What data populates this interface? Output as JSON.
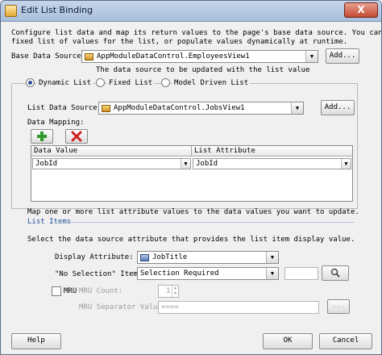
{
  "window": {
    "title": "Edit List Binding",
    "close_label": "X"
  },
  "intro": {
    "line1": "Configure list data and map its return values to the page's base data source. You can create a",
    "line2": "fixed list of values for the list, or populate values dynamically at runtime."
  },
  "base_data_source": {
    "label": "Base Data Source:",
    "value": "AppModuleDataControl.EmployeesView1",
    "add_label": "Add...",
    "help": "The data source to be updated with the list value"
  },
  "list_type": {
    "options": [
      "Dynamic List",
      "Fixed List",
      "Model Driven List"
    ],
    "selected": "Dynamic List"
  },
  "list_data_source": {
    "label": "List Data Source:",
    "value": "AppModuleDataControl.JobsView1",
    "add_label": "Add..."
  },
  "data_mapping": {
    "label": "Data Mapping:",
    "add_icon": "add-icon",
    "delete_icon": "delete-icon",
    "columns": [
      "Data Value",
      "List Attribute"
    ],
    "rows": [
      {
        "data_value": "JobId",
        "list_attribute": "JobId"
      }
    ],
    "help": "Map one or more list attribute values to the data values you want to update."
  },
  "list_items": {
    "section_label": "List Items",
    "instruction": "Select the data source attribute that provides the list item display value.",
    "display_attribute": {
      "label": "Display Attribute:",
      "value": "JobTitle",
      "icon": "attribute-icon"
    },
    "no_selection": {
      "label": "\"No Selection\" Item:",
      "value": "Selection Required"
    },
    "mru": {
      "label": "MRU",
      "checked": false
    },
    "mru_count": {
      "label": "MRU Count:",
      "value": "1"
    },
    "mru_separator": {
      "label": "MRU Separator Value:",
      "value": "===="
    }
  },
  "footer": {
    "help_label": "Help",
    "ok_label": "OK",
    "cancel_label": "Cancel"
  },
  "colors": {
    "title_bar": "#b3c7e2",
    "close_button": "#c44a33",
    "section_label": "#1f4f9a",
    "add_icon": "#2e9a2e",
    "delete_icon": "#d02020"
  }
}
